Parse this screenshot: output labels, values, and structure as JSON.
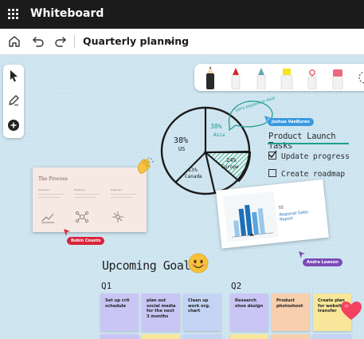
{
  "app": {
    "title": "Whiteboard"
  },
  "toolbar": {
    "home_icon": "home-icon",
    "undo_icon": "undo-icon",
    "redo_icon": "redo-icon",
    "board_name": "Quarterly planning",
    "dropdown_icon": "chevron-down-icon"
  },
  "left_tools": [
    "select-arrow-icon",
    "pen-icon",
    "add-icon"
  ],
  "pen_tray": [
    {
      "name": "black-pen",
      "color": "#1f1f1f"
    },
    {
      "name": "red-pen",
      "color": "#d8232a"
    },
    {
      "name": "teal-pen",
      "color": "#64a9b5"
    },
    {
      "name": "yellow-highlighter",
      "color": "#f2e420"
    },
    {
      "name": "lasso-tool",
      "color": "#e35d6a"
    },
    {
      "name": "eraser",
      "color": "#e96b7e"
    },
    {
      "name": "ruler",
      "color": "#555555"
    }
  ],
  "pie": {
    "slices": [
      {
        "label": "38%",
        "sublabel": "US"
      },
      {
        "label": "38%",
        "sublabel": "Asia"
      },
      {
        "label": "24%",
        "sublabel": "Europe"
      },
      {
        "label": "13%",
        "sublabel": "Canada"
      }
    ],
    "annotation": "Let's expand in Asia"
  },
  "process_card": {
    "title": "The Process",
    "columns": [
      "Heading 1",
      "Heading 2",
      "Heading 3"
    ]
  },
  "sales_card": {
    "number": "02",
    "title": "Regional Sales Report"
  },
  "tasks": {
    "title": "Product Launch Tasks",
    "items": [
      {
        "label": "Update progress",
        "checked": true
      },
      {
        "label": "Create roadmap",
        "checked": false
      }
    ]
  },
  "collaborators": [
    {
      "name": "Joshua VanBuren",
      "color": "#3a98e0"
    },
    {
      "name": "Robin Counts",
      "color": "#d6243a"
    },
    {
      "name": "Andre Lawson",
      "color": "#7b4bb7"
    }
  ],
  "goals": {
    "title": "Upcoming Goals",
    "q1": {
      "label": "Q1",
      "notes": [
        {
          "text": "Set up crit schedule",
          "color": "#c9c6f5"
        },
        {
          "text": "plan out social media for the next 3 months",
          "color": "#c9c6f5"
        },
        {
          "text": "Clean up work org. chart",
          "color": "#c4d4f5"
        }
      ]
    },
    "q2": {
      "label": "Q2",
      "notes": [
        {
          "text": "Research shoe design",
          "color": "#c9c6f5"
        },
        {
          "text": "Product photoshoot",
          "color": "#f7cfae"
        },
        {
          "text": "Create plan for website transfer",
          "color": "#f8e79a"
        }
      ]
    }
  }
}
